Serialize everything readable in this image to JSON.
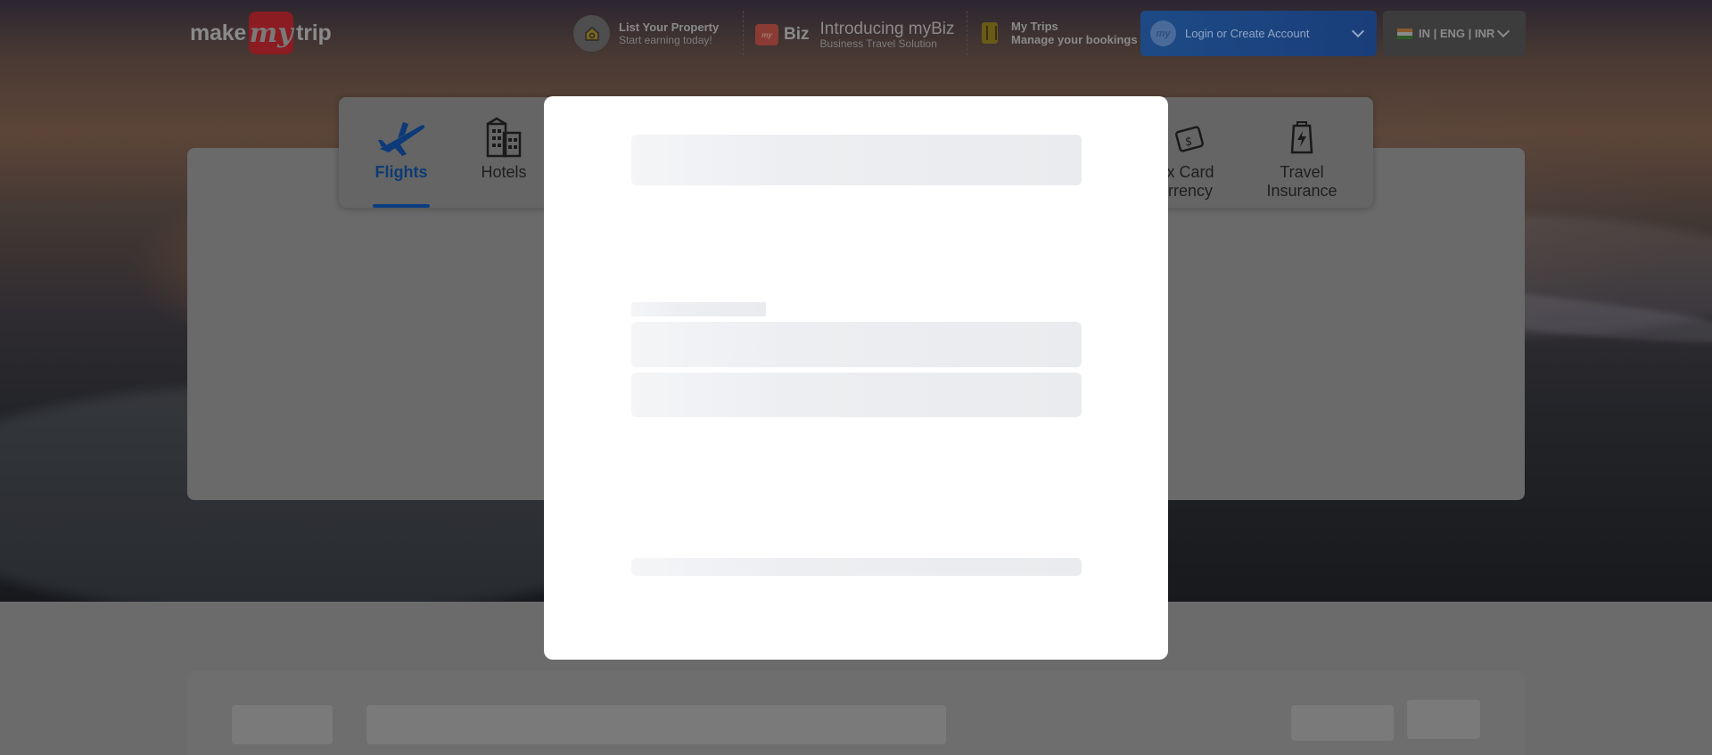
{
  "header": {
    "logo": {
      "word1": "make",
      "word2": "my",
      "word3": "trip"
    },
    "list_property": {
      "title": "List Your Property",
      "subtitle": "Start earning today!"
    },
    "mybiz": {
      "badge": "Biz",
      "badge_mini": "my",
      "title": "Introducing myBiz",
      "subtitle": "Business Travel Solution"
    },
    "my_trips": {
      "title": "My Trips",
      "subtitle": "Manage your bookings"
    },
    "login": {
      "avatar": "my",
      "label": "Login or Create Account"
    },
    "locale": {
      "label": "IN | ENG | INR"
    }
  },
  "tabs": [
    {
      "label": "Flights",
      "icon": "plane-icon",
      "active": true
    },
    {
      "label": "Hotels",
      "icon": "building-icon",
      "active": false
    },
    {
      "label": "x Card\nrrency",
      "icon": "forex-card-icon",
      "active": false
    },
    {
      "label": "Travel\nInsurance",
      "icon": "insurance-icon",
      "active": false
    }
  ],
  "modal": {
    "state": "loading"
  },
  "colors": {
    "brand_red": "#e52d27",
    "primary_blue": "#008cff",
    "active_tab_blue": "#1a7fe0",
    "skeleton": "#eceef1"
  }
}
